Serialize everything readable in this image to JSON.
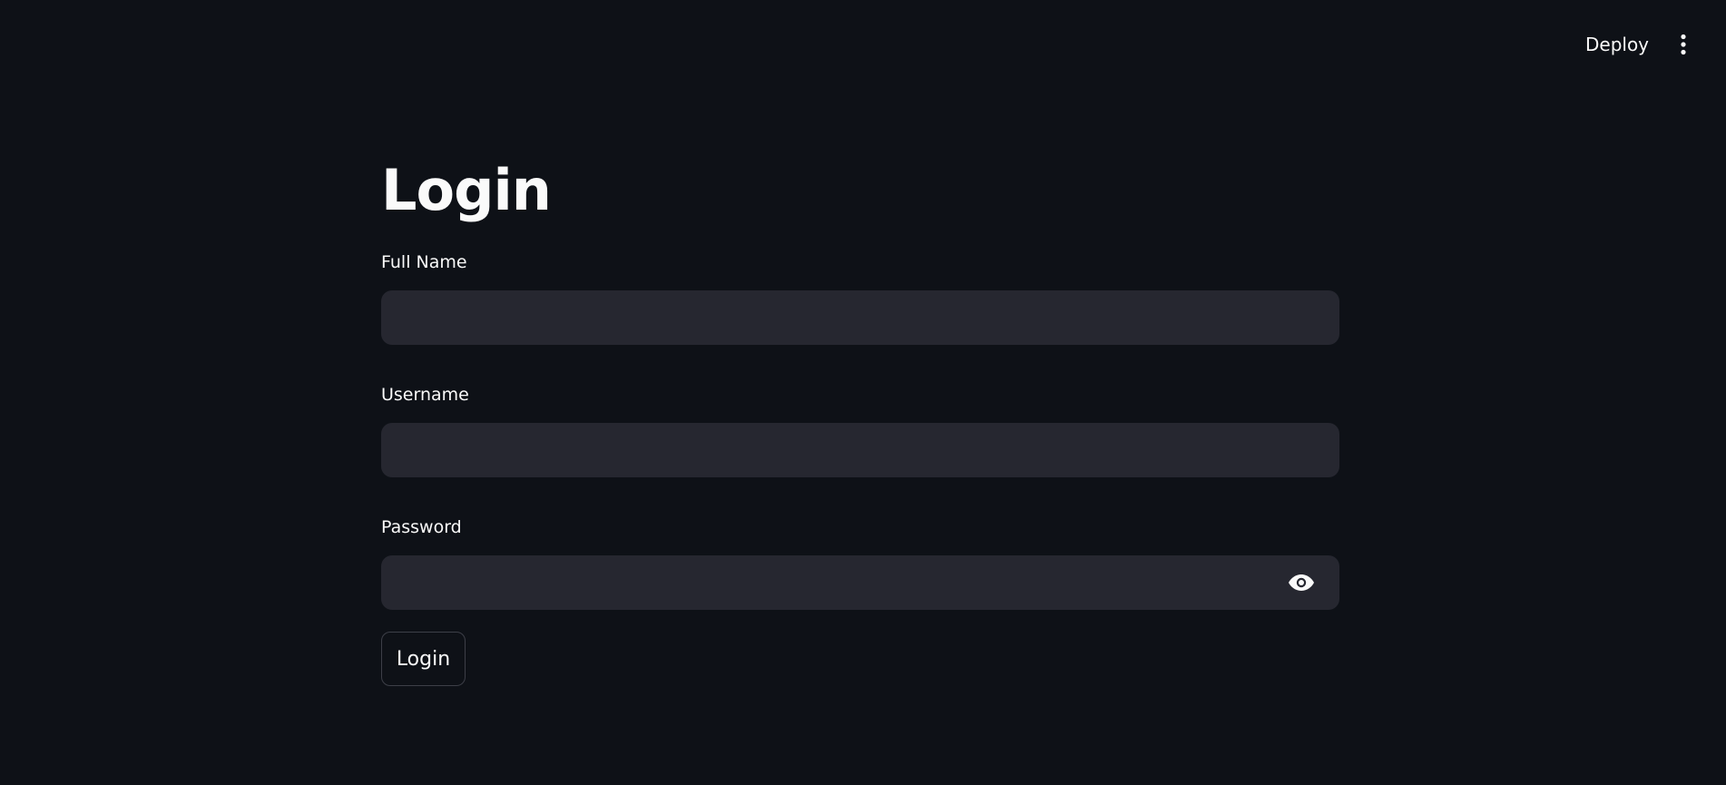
{
  "header": {
    "deploy_label": "Deploy",
    "menu_icon": "vertical-ellipsis-icon"
  },
  "main": {
    "title": "Login",
    "fields": {
      "full_name": {
        "label": "Full Name",
        "value": "",
        "placeholder": ""
      },
      "username": {
        "label": "Username",
        "value": "",
        "placeholder": ""
      },
      "password": {
        "label": "Password",
        "value": "",
        "placeholder": "",
        "toggle_icon": "eye-icon"
      }
    },
    "submit_label": "Login"
  },
  "colors": {
    "background": "#0e1117",
    "input_background": "#262730",
    "text": "#fafafa",
    "button_border": "#3d3f48"
  }
}
